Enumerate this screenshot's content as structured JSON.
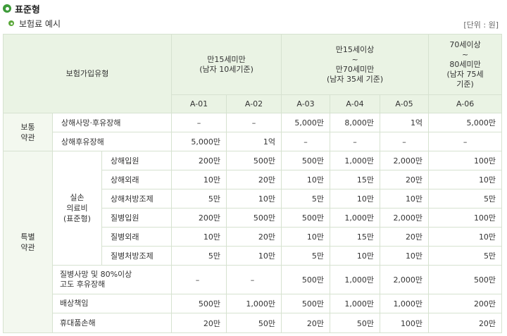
{
  "page": {
    "title": "표준형",
    "subtitle": "보험료 예시",
    "unit": "[단위 : 원]"
  },
  "table": {
    "header": {
      "type_label": "보험가입유형",
      "group1": [
        "만15세미만",
        "(남자 10세기준)"
      ],
      "group2": [
        "만15세이상",
        "~",
        "만70세미만",
        "(남자 35세 기준)"
      ],
      "group3": [
        "70세이상",
        "~",
        "80세미만",
        "(남자 75세",
        "기준)"
      ],
      "plans": [
        "A-01",
        "A-02",
        "A-03",
        "A-04",
        "A-05",
        "A-06"
      ]
    },
    "general": {
      "label": [
        "보통",
        "약관"
      ],
      "rows": [
        {
          "name": "상해사망·후유장해",
          "values": [
            "–",
            "–",
            "5,000만",
            "8,000만",
            "1억",
            "5,000만"
          ]
        },
        {
          "name": "상해후유장해",
          "values": [
            "5,000만",
            "1억",
            "–",
            "–",
            "–",
            "–"
          ]
        }
      ]
    },
    "special": {
      "label": [
        "특별",
        "약관"
      ],
      "medical_label": [
        "실손",
        "의료비",
        "(표준형)"
      ],
      "medical_rows": [
        {
          "name": "상해입원",
          "values": [
            "200만",
            "500만",
            "500만",
            "1,000만",
            "2,000만",
            "100만"
          ]
        },
        {
          "name": "상해외래",
          "values": [
            "10만",
            "20만",
            "10만",
            "15만",
            "20만",
            "10만"
          ]
        },
        {
          "name": "상해처방조제",
          "values": [
            "5만",
            "10만",
            "5만",
            "10만",
            "10만",
            "5만"
          ]
        },
        {
          "name": "질병입원",
          "values": [
            "200만",
            "500만",
            "500만",
            "1,000만",
            "2,000만",
            "100만"
          ]
        },
        {
          "name": "질병외래",
          "values": [
            "10만",
            "20만",
            "10만",
            "15만",
            "20만",
            "10만"
          ]
        },
        {
          "name": "질병처방조제",
          "values": [
            "5만",
            "10만",
            "5만",
            "10만",
            "10만",
            "5만"
          ]
        }
      ],
      "other_rows": [
        {
          "name": [
            "질병사망 및 80%이상",
            "고도 후유장해"
          ],
          "values": [
            "–",
            "–",
            "500만",
            "1,000만",
            "2,000만",
            "500만"
          ]
        },
        {
          "name": [
            "배상책임"
          ],
          "values": [
            "500만",
            "1,000만",
            "500만",
            "1,000만",
            "1,000만",
            "200만"
          ]
        },
        {
          "name": [
            "휴대품손해"
          ],
          "values": [
            "20만",
            "50만",
            "20만",
            "50만",
            "100만",
            "20만"
          ]
        }
      ]
    }
  }
}
